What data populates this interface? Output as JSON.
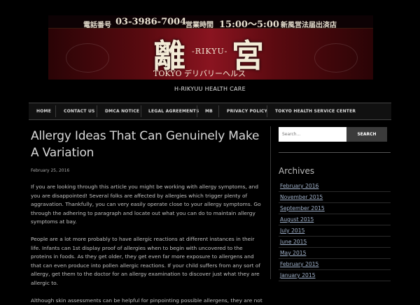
{
  "header": {
    "banner": {
      "phone_label": "電話番号",
      "phone": "03-3986-7004",
      "hours_label": "営業時間",
      "hours": "15:00～5:00",
      "license": "新風営法届出済店",
      "logo_left": "離",
      "logo_right": "宮",
      "logo_rikyu": "-RIKYU-",
      "logo_sub": "TOKYO デリバリーヘルス"
    },
    "tagline": "H-RIKYUU HEALTH CARE"
  },
  "nav": {
    "items": [
      {
        "label": "HOME"
      },
      {
        "label": "CONTACT US"
      },
      {
        "label": "DMCA NOTICE"
      },
      {
        "label": "LEGAL AGREEMENTS"
      },
      {
        "label": "MB"
      },
      {
        "label": "PRIVACY POLICY"
      },
      {
        "label": "TOKYO HEALTH SERVICE CENTER"
      }
    ]
  },
  "article": {
    "title": "Allergy Ideas That Can Genuinely Make A Variation",
    "date": "February 25, 2016",
    "paragraphs": [
      "If you are looking through this article you might be working with allergy symptoms, and you are disappointed! Several folks are affected by allergies which trigger plenty of aggravation. Thankfully, you can very easily operate close to your allergy symptoms. Go through the adhering to paragraph and locate out what you can do to maintain allergy symptoms at bay.",
      "People are a lot more probably to have allergic reactions at different instances in their life. Infants can 1st display proof of allergies when to begin with uncovered to the proteins in foods. As they get older, they get even far more exposure to allergens and that can even produce into pollen allergic reactions. If your child suffers from any sort of allergy, get them to the doctor for an allergy examination to discover just what they are allergic to.",
      "Although skin assessments can be helpful for pinpointing possible allergens, they are not"
    ]
  },
  "sidebar": {
    "search": {
      "placeholder": "Search...",
      "button": "SEARCH"
    },
    "archives": {
      "title": "Archives",
      "items": [
        {
          "label": "February 2016"
        },
        {
          "label": "November 2015"
        },
        {
          "label": "September 2015"
        },
        {
          "label": "August 2015"
        },
        {
          "label": "July 2015"
        },
        {
          "label": "June 2015"
        },
        {
          "label": "May 2015"
        },
        {
          "label": "February 2015"
        },
        {
          "label": "January 2015"
        }
      ]
    }
  }
}
